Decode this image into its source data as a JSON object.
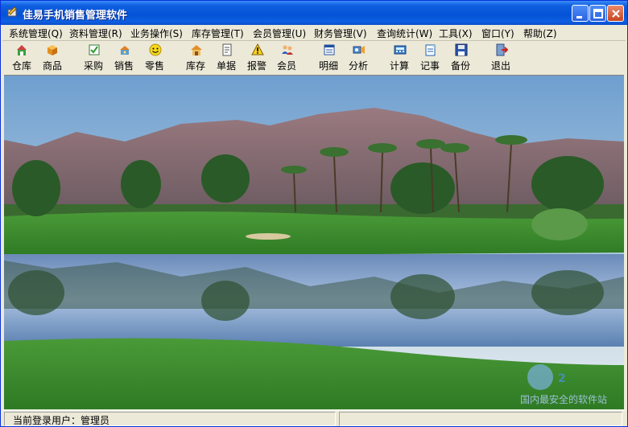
{
  "window": {
    "title": "佳易手机销售管理软件"
  },
  "menu": [
    "系统管理(Q)",
    "资料管理(R)",
    "业务操作(S)",
    "库存管理(T)",
    "会员管理(U)",
    "财务管理(V)",
    "查询统计(W)",
    "工具(X)",
    "窗口(Y)",
    "帮助(Z)"
  ],
  "toolbar": [
    {
      "label": "仓库",
      "icon": "warehouse-icon"
    },
    {
      "label": "商品",
      "icon": "box-icon"
    },
    {
      "label": "采购",
      "icon": "purchase-icon"
    },
    {
      "label": "销售",
      "icon": "sale-icon"
    },
    {
      "label": "零售",
      "icon": "smiley-icon"
    },
    {
      "label": "库存",
      "icon": "stock-icon"
    },
    {
      "label": "单据",
      "icon": "document-icon"
    },
    {
      "label": "报警",
      "icon": "warning-icon"
    },
    {
      "label": "会员",
      "icon": "members-icon"
    },
    {
      "label": "明细",
      "icon": "details-icon"
    },
    {
      "label": "分析",
      "icon": "analysis-icon"
    },
    {
      "label": "计算",
      "icon": "calculator-icon"
    },
    {
      "label": "记事",
      "icon": "note-icon"
    },
    {
      "label": "备份",
      "icon": "floppy-icon"
    },
    {
      "label": "退出",
      "icon": "exit-icon"
    }
  ],
  "status": {
    "user_label": "当前登录用户：管理员"
  },
  "watermark": {
    "text": "国内最安全的软件站"
  }
}
